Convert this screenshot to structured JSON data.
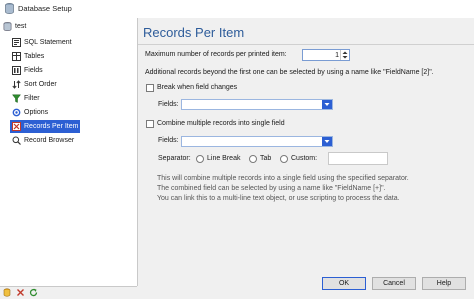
{
  "window": {
    "title": "Database Setup"
  },
  "sidebar": {
    "root": "test",
    "items": [
      {
        "label": "SQL Statement",
        "icon": "sql-icon"
      },
      {
        "label": "Tables",
        "icon": "table-icon"
      },
      {
        "label": "Fields",
        "icon": "fields-icon"
      },
      {
        "label": "Sort Order",
        "icon": "sort-icon"
      },
      {
        "label": "Filter",
        "icon": "filter-icon"
      },
      {
        "label": "Options",
        "icon": "options-icon"
      },
      {
        "label": "Records Per Item",
        "icon": "records-icon",
        "selected": true
      },
      {
        "label": "Record Browser",
        "icon": "browser-icon"
      }
    ]
  },
  "main": {
    "heading": "Records Per Item",
    "max_records_label": "Maximum number of records per printed item:",
    "max_records_value": "1",
    "additional_info": "Additional records beyond the first one can be selected by using a name like \"FieldName [2]\".",
    "break_label": "Break when field changes",
    "fields_label_1": "Fields:",
    "combine_label": "Combine multiple records into single field",
    "fields_label_2": "Fields:",
    "separator_label": "Separator:",
    "radio_line_break": "Line Break",
    "radio_tab": "Tab",
    "radio_custom": "Custom:",
    "note_1": "This will combine multiple records into a single field using the specified separator.",
    "note_2": "The combined field can be selected by using a name like \"FieldName [+]\".",
    "note_3": "You can link this to a multi-line text object, or use scripting to process the data."
  },
  "buttons": {
    "ok": "OK",
    "cancel": "Cancel",
    "help": "Help"
  },
  "colors": {
    "accent": "#2c5fd3",
    "heading": "#2e5c9a"
  }
}
